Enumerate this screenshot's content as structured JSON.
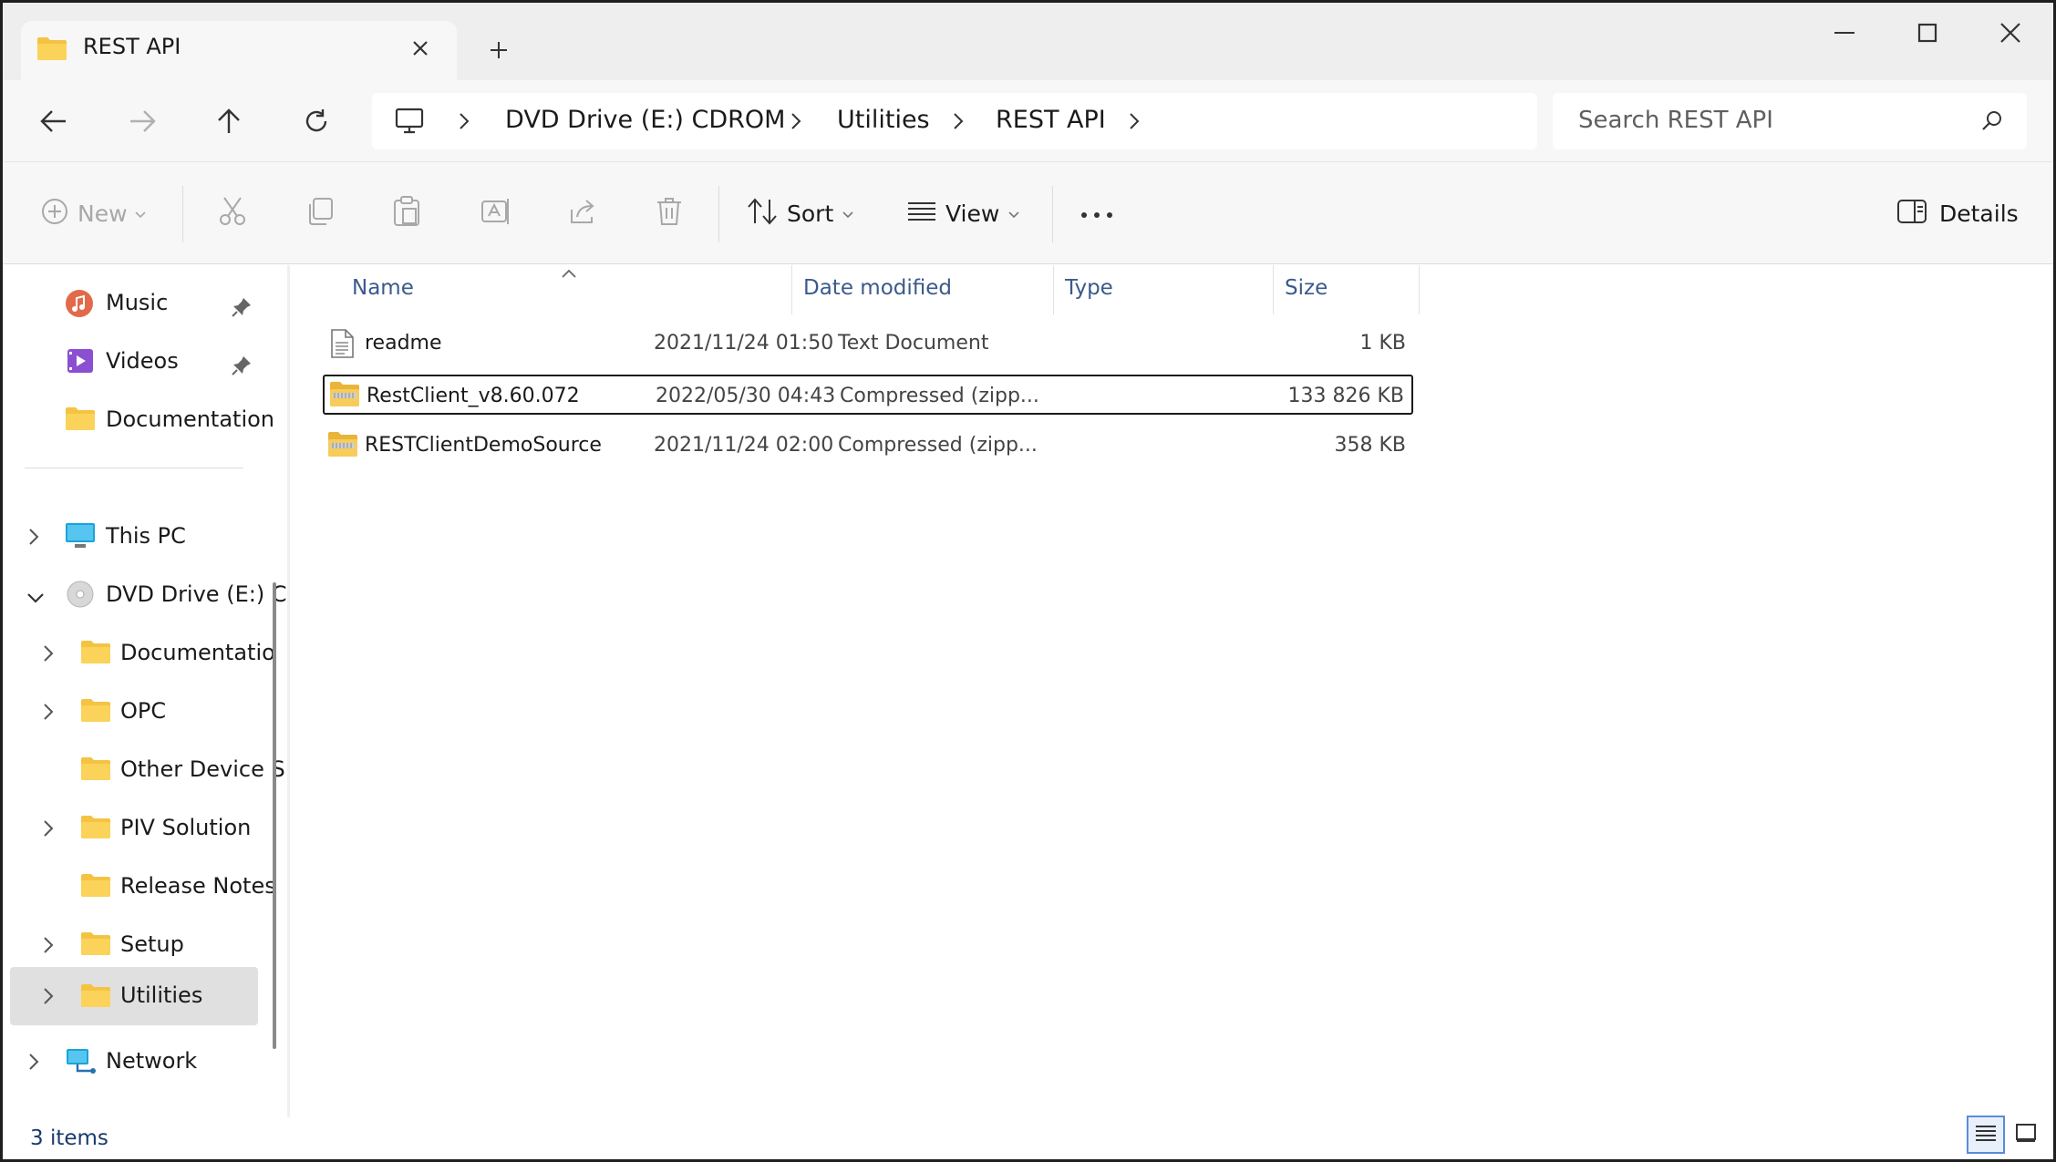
{
  "window": {
    "tab_title": "REST API",
    "minimize_icon": "minimize-icon",
    "maximize_icon": "maximize-icon",
    "close_icon": "close-icon"
  },
  "address": {
    "breadcrumbs": [
      "DVD Drive (E:) CDROM",
      "Utilities",
      "REST API"
    ],
    "search_placeholder": "Search REST API"
  },
  "commands": {
    "new": "New",
    "sort": "Sort",
    "view": "View",
    "details": "Details"
  },
  "nav": {
    "quick_access": [
      {
        "label": "Music",
        "icon": "music-icon",
        "pinned": true
      },
      {
        "label": "Videos",
        "icon": "videos-icon",
        "pinned": true
      },
      {
        "label": "Documentation",
        "icon": "folder-icon",
        "pinned": false
      }
    ],
    "tree": [
      {
        "label": "This PC",
        "icon": "computer-icon",
        "expander": "collapsed"
      },
      {
        "label": "DVD Drive (E:) C",
        "icon": "dvd-icon",
        "expander": "expanded"
      },
      {
        "label": "Documentatio",
        "icon": "folder-icon",
        "expander": "collapsed"
      },
      {
        "label": "OPC",
        "icon": "folder-icon",
        "expander": "collapsed"
      },
      {
        "label": "Other Device S",
        "icon": "folder-icon",
        "expander": "none"
      },
      {
        "label": "PIV Solution",
        "icon": "folder-icon",
        "expander": "collapsed"
      },
      {
        "label": "Release Notes",
        "icon": "folder-icon",
        "expander": "none"
      },
      {
        "label": "Setup",
        "icon": "folder-icon",
        "expander": "collapsed"
      },
      {
        "label": "Utilities",
        "icon": "folder-icon",
        "expander": "collapsed",
        "selected": true
      },
      {
        "label": "Network",
        "icon": "network-icon",
        "expander": "collapsed"
      }
    ]
  },
  "files": {
    "columns": [
      "Name",
      "Date modified",
      "Type",
      "Size"
    ],
    "rows": [
      {
        "name": "readme",
        "date": "2021/11/24 01:50",
        "type": "Text Document",
        "size": "1 KB",
        "icon": "text-file-icon"
      },
      {
        "name": "RestClient_v8.60.072",
        "date": "2022/05/30 04:43",
        "type": "Compressed (zipp...",
        "size": "133 826 KB",
        "icon": "zip-folder-icon",
        "focused": true
      },
      {
        "name": "RESTClientDemoSource",
        "date": "2021/11/24 02:00",
        "type": "Compressed (zipp...",
        "size": "358 KB",
        "icon": "zip-folder-icon"
      }
    ]
  },
  "status": {
    "item_count": "3 items"
  },
  "colors": {
    "accent": "#3a5a8c",
    "folder": "#f5c342",
    "selected_bg": "#e0e0e0"
  }
}
